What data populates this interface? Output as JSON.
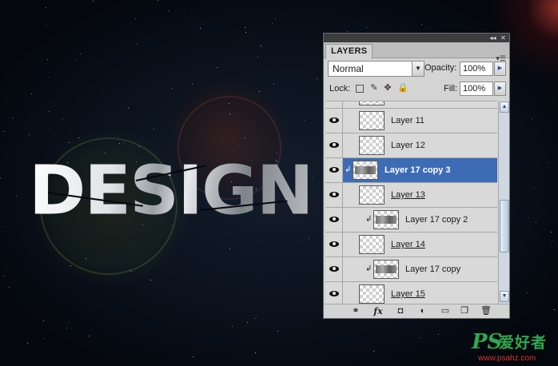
{
  "canvas": {
    "headline": "DESIGN"
  },
  "layers_panel": {
    "tab_label": "LAYERS",
    "panel_menu_icon": "panel-menu-icon",
    "blend_mode": "Normal",
    "opacity_label": "Opacity:",
    "opacity_value": "100%",
    "lock_label": "Lock:",
    "fill_label": "Fill:",
    "fill_value": "100%",
    "layers": [
      {
        "name": "",
        "visible": true,
        "clipped": false,
        "selected": false,
        "thumbnail": "transparent",
        "underline": false
      },
      {
        "name": "Layer 11",
        "visible": true,
        "clipped": false,
        "selected": false,
        "thumbnail": "transparent",
        "underline": false
      },
      {
        "name": "Layer 12",
        "visible": true,
        "clipped": false,
        "selected": false,
        "thumbnail": "transparent",
        "underline": false
      },
      {
        "name": "Layer 17 copy 3",
        "visible": true,
        "clipped": true,
        "selected": true,
        "thumbnail": "texture",
        "underline": false
      },
      {
        "name": "Layer 13",
        "visible": true,
        "clipped": false,
        "selected": false,
        "thumbnail": "transparent",
        "underline": true
      },
      {
        "name": "Layer 17 copy 2",
        "visible": true,
        "clipped": true,
        "selected": false,
        "thumbnail": "texture",
        "underline": false
      },
      {
        "name": "Layer 14",
        "visible": true,
        "clipped": false,
        "selected": false,
        "thumbnail": "transparent",
        "underline": true
      },
      {
        "name": "Layer 17 copy",
        "visible": true,
        "clipped": true,
        "selected": false,
        "thumbnail": "texture",
        "underline": false
      },
      {
        "name": "Layer 15",
        "visible": true,
        "clipped": false,
        "selected": false,
        "thumbnail": "transparent",
        "underline": true
      }
    ],
    "bottom_tools": [
      "link-layers-icon",
      "fx-icon",
      "add-mask-icon",
      "adjustment-layer-icon",
      "new-group-icon",
      "new-layer-icon",
      "delete-layer-icon"
    ],
    "selection_color": "#3e6cb4"
  },
  "watermark": {
    "logo": "PS",
    "chinese": "爱好者",
    "url": "www.psahz.com"
  }
}
